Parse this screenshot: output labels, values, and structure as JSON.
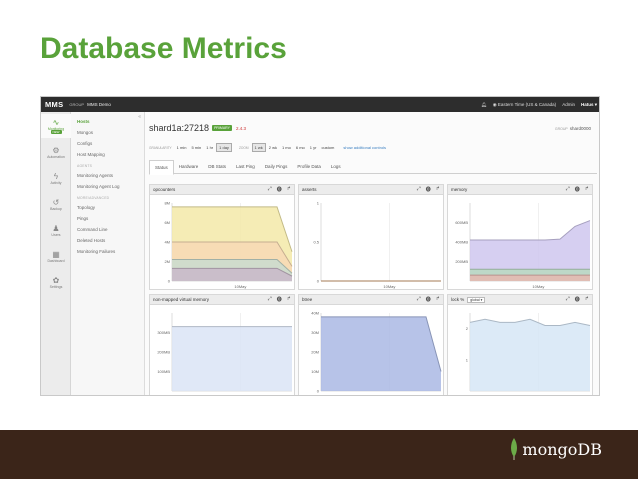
{
  "slide": {
    "title": "Database Metrics",
    "footer_logo_text": "mongoDB"
  },
  "topbar": {
    "brand": "MMS",
    "group_label": "GROUP",
    "group_name": "MMS Demo",
    "timezone": "Eastern Time (US & Canada)",
    "admin": "Admin",
    "user": "Hatus"
  },
  "leftnav": {
    "items": [
      {
        "label": "Monitoring",
        "icon": "monitoring-icon",
        "glyph": "∿"
      },
      {
        "label": "Automation",
        "icon": "automation-icon",
        "glyph": "⚙"
      },
      {
        "label": "Activity",
        "icon": "activity-icon",
        "glyph": "ϟ"
      },
      {
        "label": "Backup",
        "icon": "backup-icon",
        "glyph": "↺"
      },
      {
        "label": "Users",
        "icon": "users-icon",
        "glyph": "♟"
      },
      {
        "label": "Dashboard",
        "icon": "dashboard-icon",
        "glyph": "▦"
      },
      {
        "label": "Settings",
        "icon": "settings-icon",
        "glyph": "✿"
      }
    ],
    "new_badge": "NEW"
  },
  "subnav": {
    "collapse_glyph": "«",
    "items": [
      "Hosts",
      "Mongos",
      "Configs",
      "Host Mapping"
    ],
    "agents_heading": "AGENTS",
    "agents_items": [
      "Monitoring Agents",
      "Monitoring Agent Log"
    ],
    "more_heading": "MORE/ADVANCED",
    "more_items": [
      "Topology",
      "Pings",
      "Command Line",
      "Deleted Hosts",
      "Monitoring Failures"
    ]
  },
  "host": {
    "name": "shard1a:27218",
    "role": "PRIMARY",
    "version": "2.4.3",
    "group_label": "GROUP",
    "group_value": "shard0000"
  },
  "granularity": {
    "label": "GRANULARITY",
    "options": [
      "1 min",
      "5 min",
      "1 hr",
      "1 day"
    ],
    "selected": "1 day"
  },
  "zoom": {
    "label": "ZOOM",
    "options": [
      "1 wk",
      "2 wk",
      "1 mo",
      "6 mo",
      "1 yr",
      "custom"
    ],
    "selected": "1 wk",
    "link": "show additional controls"
  },
  "tabs": [
    "Status",
    "Hardware",
    "DB Stats",
    "Last Ping",
    "Daily Pings",
    "Profile Data",
    "Logs"
  ],
  "panel_tools": [
    "⤢",
    "⓿",
    "↱"
  ],
  "chart_data": [
    {
      "type": "area",
      "title": "opcounters",
      "x": [
        "",
        "10May",
        ""
      ],
      "ylim": [
        0,
        8
      ],
      "yticks": [
        "0",
        "2M",
        "4M",
        "6M",
        "8M"
      ],
      "series": [
        {
          "color": "#f3e9a8",
          "values": [
            7.6,
            7.6,
            7.6,
            7.6,
            7.6,
            7.6,
            7.6,
            7.6,
            3.0
          ]
        },
        {
          "color": "#f7d9b5",
          "values": [
            4.0,
            4.0,
            4.0,
            4.0,
            4.0,
            4.0,
            4.0,
            4.0,
            1.5
          ]
        },
        {
          "color": "#c9dcd0",
          "values": [
            2.2,
            2.2,
            2.2,
            2.2,
            2.2,
            2.2,
            2.2,
            2.2,
            0.8
          ]
        },
        {
          "color": "#c9b9c9",
          "values": [
            1.3,
            1.3,
            1.3,
            1.3,
            1.3,
            1.3,
            1.3,
            1.3,
            0.5
          ]
        }
      ]
    },
    {
      "type": "line",
      "title": "asserts",
      "x": [
        "",
        "10May",
        ""
      ],
      "ylim": [
        0,
        1
      ],
      "yticks": [
        "0",
        "0.5",
        "1"
      ],
      "series": [
        {
          "color": "#cf9a6a",
          "values": [
            0,
            0,
            0,
            0,
            0,
            0,
            0,
            0,
            0
          ]
        }
      ]
    },
    {
      "type": "area",
      "title": "memory",
      "x": [
        "",
        "10May",
        ""
      ],
      "ylim": [
        0,
        800
      ],
      "yticks": [
        "200MB",
        "400MB",
        "600MB"
      ],
      "series": [
        {
          "color": "#cfc7ee",
          "values": [
            420,
            420,
            420,
            420,
            420,
            420,
            430,
            560,
            620
          ]
        },
        {
          "color": "#b9d9c1",
          "values": [
            120,
            120,
            120,
            120,
            120,
            120,
            120,
            120,
            120
          ]
        },
        {
          "color": "#e6b8b0",
          "values": [
            60,
            60,
            60,
            60,
            60,
            60,
            60,
            60,
            60
          ]
        }
      ]
    },
    {
      "type": "area",
      "title": "non-mapped virtual memory",
      "x": [
        "",
        "10May",
        ""
      ],
      "ylim": [
        0,
        400
      ],
      "yticks": [
        "100MB",
        "200MB",
        "300MB"
      ],
      "series": [
        {
          "color": "#dbe4f6",
          "values": [
            330,
            330,
            330,
            330,
            330,
            330,
            330,
            330,
            330
          ]
        }
      ]
    },
    {
      "type": "area",
      "title": "btree",
      "x": [
        "",
        "10May",
        ""
      ],
      "ylim": [
        0,
        40
      ],
      "yticks": [
        "0",
        "10M",
        "20M",
        "30M",
        "40M"
      ],
      "series": [
        {
          "color": "#aab9e4",
          "values": [
            38,
            38,
            38,
            38,
            38,
            38,
            38,
            38,
            10
          ]
        }
      ]
    },
    {
      "type": "area",
      "title": "lock %",
      "selector": "global",
      "x": [
        "",
        "10May",
        ""
      ],
      "ylim": [
        0,
        2.5
      ],
      "yticks": [
        "1",
        "2"
      ],
      "series": [
        {
          "color": "#d6e6f6",
          "values": [
            2.2,
            2.3,
            2.2,
            2.2,
            2.3,
            2.1,
            2.1,
            2.2,
            2.1
          ]
        }
      ]
    }
  ]
}
